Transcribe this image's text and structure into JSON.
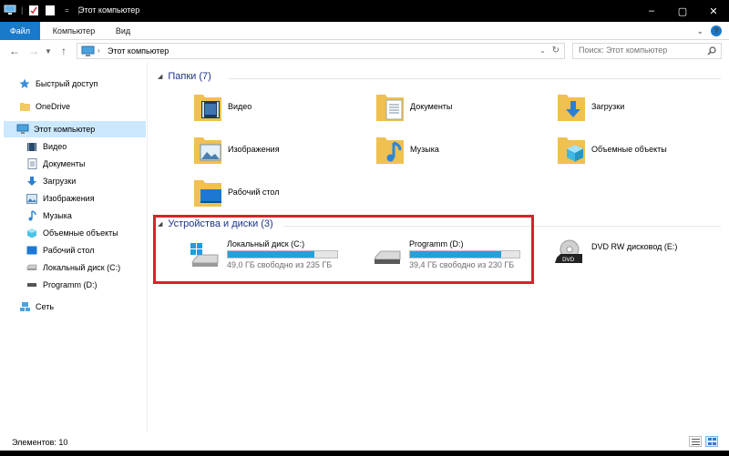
{
  "window": {
    "title": "Этот компьютер"
  },
  "ribbon": {
    "tabs": [
      {
        "label": "Файл"
      },
      {
        "label": "Компьютер"
      },
      {
        "label": "Вид"
      }
    ]
  },
  "address": {
    "crumb": "Этот компьютер",
    "search_placeholder": "Поиск: Этот компьютер"
  },
  "sidebar": {
    "items": [
      {
        "label": "Быстрый доступ",
        "icon": "star-icon"
      },
      {
        "label": "OneDrive",
        "icon": "onedrive-icon"
      },
      {
        "label": "Этот компьютер",
        "icon": "computer-icon",
        "selected": true
      },
      {
        "label": "Видео",
        "icon": "video-icon"
      },
      {
        "label": "Документы",
        "icon": "documents-icon"
      },
      {
        "label": "Загрузки",
        "icon": "downloads-icon"
      },
      {
        "label": "Изображения",
        "icon": "pictures-icon"
      },
      {
        "label": "Музыка",
        "icon": "music-icon"
      },
      {
        "label": "Объемные объекты",
        "icon": "3d-objects-icon"
      },
      {
        "label": "Рабочий стол",
        "icon": "desktop-icon"
      },
      {
        "label": "Локальный диск (C:)",
        "icon": "drive-icon"
      },
      {
        "label": "Programm (D:)",
        "icon": "drive-icon"
      },
      {
        "label": "Сеть",
        "icon": "network-icon"
      }
    ]
  },
  "main": {
    "folders_header": "Папки (7)",
    "folders": [
      {
        "label": "Видео",
        "icon": "video-folder-icon"
      },
      {
        "label": "Документы",
        "icon": "documents-folder-icon"
      },
      {
        "label": "Загрузки",
        "icon": "downloads-folder-icon"
      },
      {
        "label": "Изображения",
        "icon": "pictures-folder-icon"
      },
      {
        "label": "Музыка",
        "icon": "music-folder-icon"
      },
      {
        "label": "Объемные объекты",
        "icon": "3d-objects-folder-icon"
      },
      {
        "label": "Рабочий стол",
        "icon": "desktop-folder-icon"
      }
    ],
    "devices_header": "Устройства и диски (3)",
    "drives": [
      {
        "name": "Локальный диск (C:)",
        "free": "49,0 ГБ свободно из 235 ГБ",
        "used_fraction": 0.79,
        "icon": "windows-drive-icon"
      },
      {
        "name": "Programm (D:)",
        "free": "39,4 ГБ свободно из 230 ГБ",
        "used_fraction": 0.83,
        "icon": "hard-drive-icon"
      },
      {
        "name": "DVD RW дисковод (E:)",
        "icon": "dvd-drive-icon"
      }
    ]
  },
  "status": {
    "text": "Элементов: 10"
  },
  "colors": {
    "accent": "#1979ca",
    "bar_fill": "#26a0da",
    "highlight": "#d6232a",
    "header_text": "#1e3287"
  }
}
